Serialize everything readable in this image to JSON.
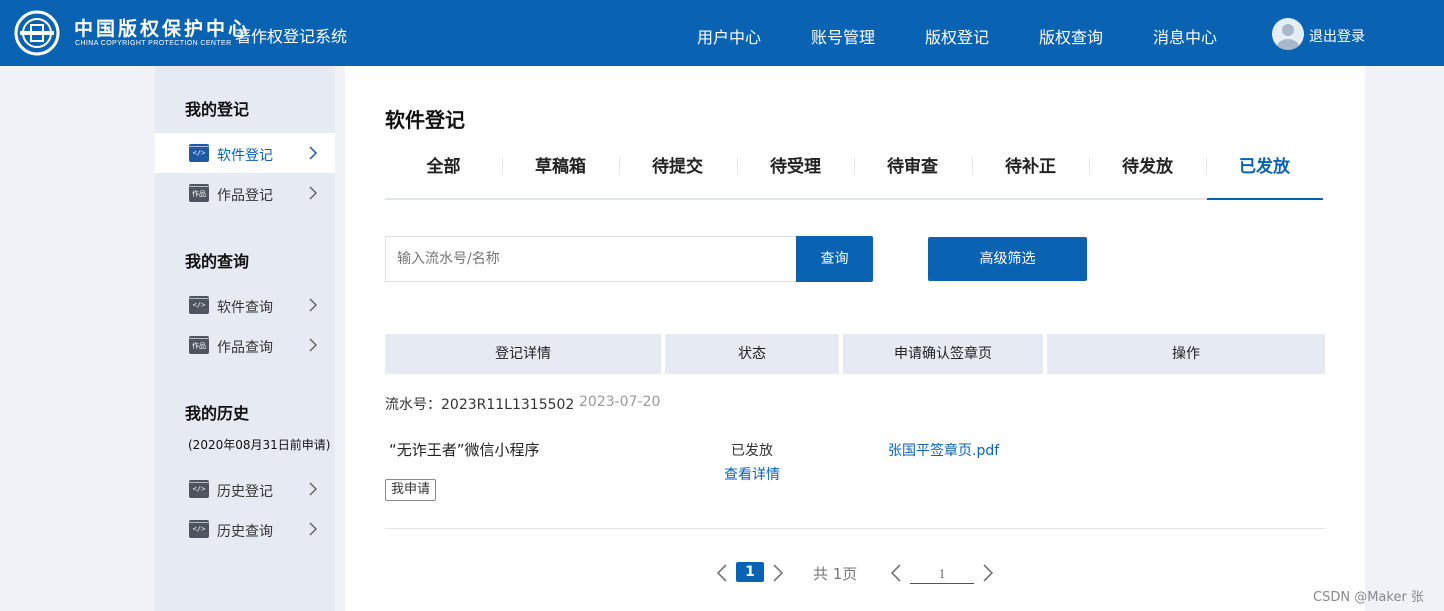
{
  "header": {
    "logo_cn": "中国版权保护中心",
    "logo_en": "CHINA COPYRIGHT PROTECTION CENTER",
    "system_title": "著作权登记系统",
    "nav": [
      "用户中心",
      "账号管理",
      "版权登记",
      "版权查询",
      "消息中心"
    ],
    "logout": "退出登录"
  },
  "sidebar": {
    "sections": [
      {
        "title": "我的登记",
        "items": [
          {
            "label": "软件登记",
            "icon": "code-icon",
            "active": true
          },
          {
            "label": "作品登记",
            "icon": "works-icon"
          }
        ]
      },
      {
        "title": "我的查询",
        "items": [
          {
            "label": "软件查询",
            "icon": "code-icon"
          },
          {
            "label": "作品查询",
            "icon": "works-icon"
          }
        ]
      },
      {
        "title": "我的历史",
        "note": "(2020年08月31日前申请)",
        "items": [
          {
            "label": "历史登记",
            "icon": "code-icon"
          },
          {
            "label": "历史查询",
            "icon": "code-icon"
          }
        ]
      }
    ]
  },
  "main": {
    "title": "软件登记",
    "tabs": [
      "全部",
      "草稿箱",
      "待提交",
      "待受理",
      "待审查",
      "待补正",
      "待发放",
      "已发放"
    ],
    "active_tab": "已发放",
    "search": {
      "placeholder": "输入流水号/名称",
      "query_button": "查询",
      "advanced_button": "高级筛选"
    },
    "table": {
      "headers": [
        "登记详情",
        "状态",
        "申请确认签章页",
        "操作"
      ],
      "rows": [
        {
          "serial": "流水号：2023R11L1315502",
          "date": "2023-07-20",
          "name": "“无诈王者”微信小程序",
          "status": "已发放",
          "detail_link": "查看详情",
          "sign_page": "张国平签章页.pdf",
          "tag": "我申请"
        }
      ]
    },
    "pagination": {
      "current": "1",
      "total": "共 1页",
      "jump_value": "1"
    }
  },
  "watermark": "CSDN @Maker 张",
  "colors": {
    "brand": "#0a62b3",
    "sidebar_bg": "#e6ebf3",
    "page_bg": "#f0f2f7"
  }
}
